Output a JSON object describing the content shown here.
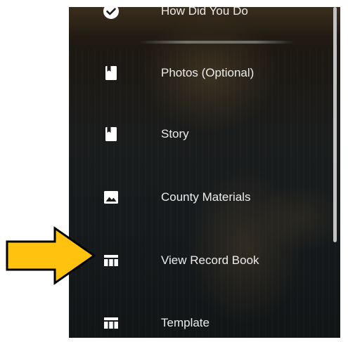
{
  "menu": {
    "items": [
      {
        "label": "How Did You Do",
        "icon": "check-circle-icon"
      },
      {
        "label": "Photos (Optional)",
        "icon": "bookmark-book-icon"
      },
      {
        "label": "Story",
        "icon": "bookmark-book-icon"
      },
      {
        "label": "County Materials",
        "icon": "image-icon"
      },
      {
        "label": "View Record Book",
        "icon": "table-icon"
      },
      {
        "label": "Template",
        "icon": "table-icon"
      }
    ]
  },
  "annotation": {
    "arrow_color": "#FFC20E",
    "arrow_outline": "#000000",
    "points_to": "View Record Book"
  },
  "colors": {
    "text": "#ECECEC",
    "icon": "#FFFFFF",
    "scroll_thumb": "#C2C2C2"
  }
}
